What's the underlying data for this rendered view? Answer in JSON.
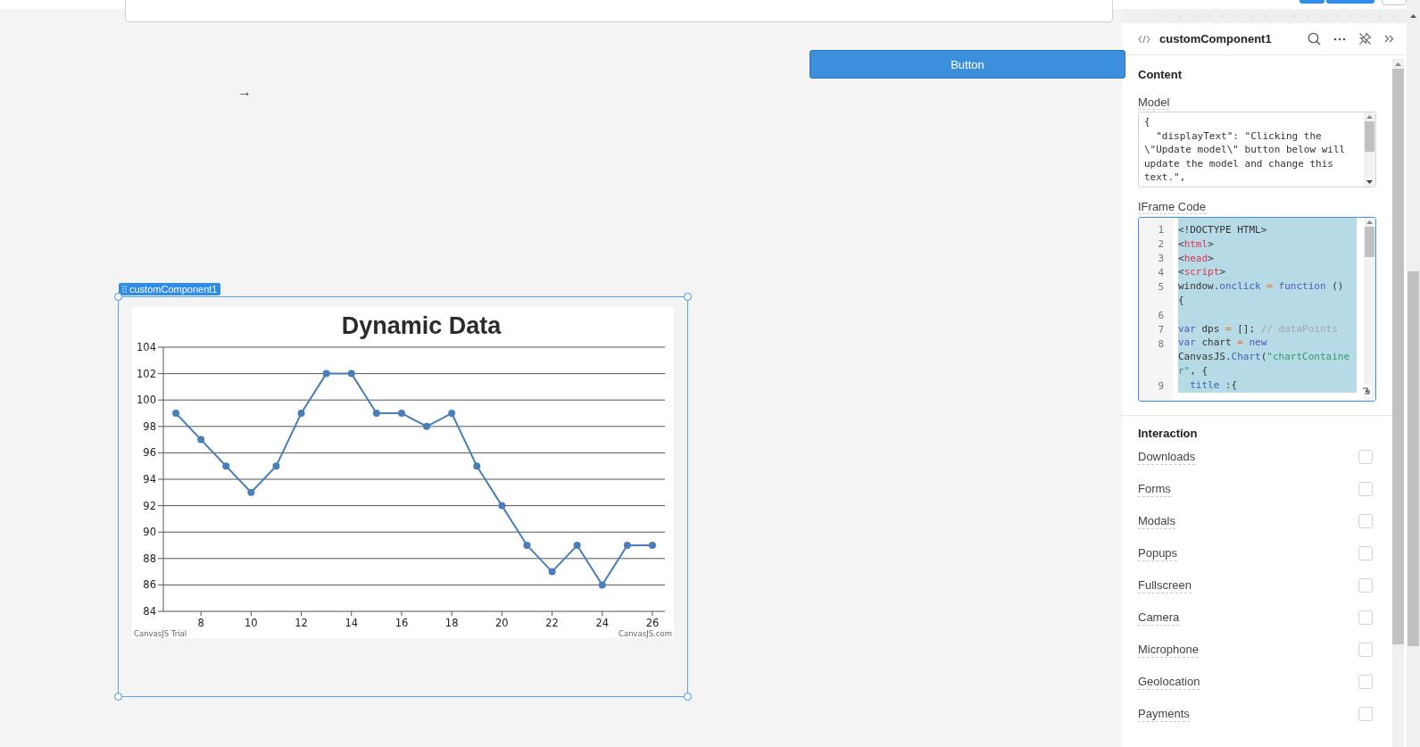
{
  "canvas": {
    "button": {
      "label": "Button"
    },
    "arrow": "→",
    "component": {
      "tag": "customComponent1",
      "selected": true,
      "chart_data": {
        "type": "line",
        "title": "Dynamic Data",
        "x": [
          7,
          8,
          9,
          10,
          11,
          12,
          13,
          14,
          15,
          16,
          17,
          18,
          19,
          20,
          21,
          22,
          23,
          24,
          25,
          26
        ],
        "grid": true,
        "series": [
          {
            "color": "#4a7ebb",
            "marker": true,
            "values": [
              99,
              97,
              95,
              93,
              95,
              99,
              102,
              102,
              99,
              99,
              98,
              99,
              95,
              92,
              89,
              87,
              89,
              86,
              89,
              89
            ]
          }
        ],
        "xlim": [
          6.5,
          26.5
        ],
        "ylim": [
          84,
          104
        ],
        "xticks": [
          8,
          10,
          12,
          14,
          16,
          18,
          20,
          22,
          24,
          26
        ],
        "yticks": [
          84,
          86,
          88,
          90,
          92,
          94,
          96,
          98,
          100,
          102,
          104
        ],
        "annotations": [
          "CanvasJS Trial",
          "CanvasJS.com"
        ]
      }
    }
  },
  "inspector": {
    "title": "customComponent1",
    "content_heading": "Content",
    "model": {
      "label": "Model",
      "value": "{\n  \"displayText\": \"Clicking the \\\"Update model\\\" button below will update the model and change this text.\","
    },
    "iframe_code": {
      "label": "IFrame Code",
      "selected": true,
      "lines": [
        {
          "number": "1",
          "tokens": [
            {
              "kind": "plain",
              "text": "<!DOCTYPE HTML>"
            }
          ]
        },
        {
          "number": "2",
          "tokens": [
            {
              "kind": "plain",
              "text": "<"
            },
            {
              "kind": "tag",
              "text": "html"
            },
            {
              "kind": "plain",
              "text": ">"
            }
          ]
        },
        {
          "number": "3",
          "tokens": [
            {
              "kind": "plain",
              "text": "<"
            },
            {
              "kind": "tag",
              "text": "head"
            },
            {
              "kind": "plain",
              "text": ">"
            }
          ]
        },
        {
          "number": "4",
          "tokens": [
            {
              "kind": "plain",
              "text": "<"
            },
            {
              "kind": "tag",
              "text": "script"
            },
            {
              "kind": "plain",
              "text": ">"
            }
          ]
        },
        {
          "number": "5",
          "tokens": [
            {
              "kind": "plain",
              "text": "window."
            },
            {
              "kind": "property",
              "text": "onclick"
            },
            {
              "kind": "operator",
              "text": " = "
            },
            {
              "kind": "keyword",
              "text": "function"
            },
            {
              "kind": "plain",
              "text": " () {"
            }
          ]
        },
        {
          "number": "6"
        },
        {
          "number": "7",
          "tokens": [
            {
              "kind": "keyword",
              "text": "var"
            },
            {
              "kind": "plain",
              "text": " dps "
            },
            {
              "kind": "operator",
              "text": "="
            },
            {
              "kind": "plain",
              "text": " []; "
            },
            {
              "kind": "comment",
              "text": "// dataPoints"
            }
          ]
        },
        {
          "number": "8",
          "tokens": [
            {
              "kind": "keyword",
              "text": "var"
            },
            {
              "kind": "plain",
              "text": " chart "
            },
            {
              "kind": "operator",
              "text": "= "
            },
            {
              "kind": "keyword",
              "text": "new"
            },
            {
              "kind": "plain",
              "text": " CanvasJS."
            },
            {
              "kind": "property",
              "text": "Chart"
            },
            {
              "kind": "plain",
              "text": "("
            },
            {
              "kind": "string",
              "text": "\"chartContainer\""
            },
            {
              "kind": "plain",
              "text": ", {"
            }
          ]
        },
        {
          "number": "9",
          "tokens": [
            {
              "kind": "property",
              "text": "  title"
            },
            {
              "kind": "plain",
              "text": " :{"
            }
          ]
        }
      ]
    },
    "interaction": {
      "heading": "Interaction",
      "options": [
        {
          "label": "Downloads",
          "checked": false
        },
        {
          "label": "Forms",
          "checked": false
        },
        {
          "label": "Modals",
          "checked": false
        },
        {
          "label": "Popups",
          "checked": false
        },
        {
          "label": "Fullscreen",
          "checked": false
        },
        {
          "label": "Camera",
          "checked": false
        },
        {
          "label": "Microphone",
          "checked": false
        },
        {
          "label": "Geolocation",
          "checked": false
        },
        {
          "label": "Payments",
          "checked": false
        }
      ]
    }
  }
}
